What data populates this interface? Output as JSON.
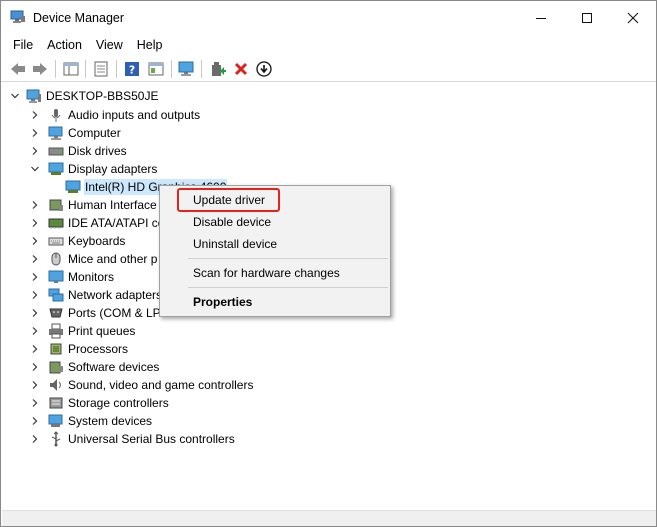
{
  "window": {
    "title": "Device Manager",
    "controls": {
      "minimize": "minimize",
      "maximize": "maximize",
      "close": "close"
    }
  },
  "menu": [
    "File",
    "Action",
    "View",
    "Help"
  ],
  "toolbar": [
    "back-icon",
    "forward-icon",
    "properties-icon",
    "show-hide-icon",
    "help-icon",
    "view-icon",
    "scan-icon",
    "update-driver-icon",
    "uninstall-icon",
    "install-icon"
  ],
  "tree": {
    "root": "DESKTOP-BBS50JE",
    "categories": [
      {
        "label": "Audio inputs and outputs",
        "icon": "audio-icon"
      },
      {
        "label": "Computer",
        "icon": "computer-icon"
      },
      {
        "label": "Disk drives",
        "icon": "disk-icon"
      },
      {
        "label": "Display adapters",
        "icon": "display-icon",
        "expanded": true
      },
      {
        "label": "Intel(R) HD Graphics 4600",
        "icon": "display-icon",
        "child": true
      },
      {
        "label": "Human Interface",
        "icon": "hid-icon"
      },
      {
        "label": "IDE ATA/ATAPI co",
        "icon": "ide-icon"
      },
      {
        "label": "Keyboards",
        "icon": "keyboard-icon"
      },
      {
        "label": "Mice and other p",
        "icon": "mouse-icon"
      },
      {
        "label": "Monitors",
        "icon": "monitor-icon"
      },
      {
        "label": "Network adapters",
        "icon": "network-icon"
      },
      {
        "label": "Ports (COM & LP",
        "icon": "port-icon"
      },
      {
        "label": "Print queues",
        "icon": "printer-icon"
      },
      {
        "label": "Processors",
        "icon": "processor-icon"
      },
      {
        "label": "Software devices",
        "icon": "software-icon"
      },
      {
        "label": "Sound, video and game controllers",
        "icon": "sound-icon"
      },
      {
        "label": "Storage controllers",
        "icon": "storage-icon"
      },
      {
        "label": "System devices",
        "icon": "system-icon"
      },
      {
        "label": "Universal Serial Bus controllers",
        "icon": "usb-icon"
      }
    ]
  },
  "context_menu": {
    "update": "Update driver",
    "disable": "Disable device",
    "uninstall": "Uninstall device",
    "scan": "Scan for hardware changes",
    "properties": "Properties"
  },
  "colors": {
    "selection": "#cce8ff",
    "highlight_border": "#e3241b",
    "menu_bg": "#f2f2f2"
  }
}
